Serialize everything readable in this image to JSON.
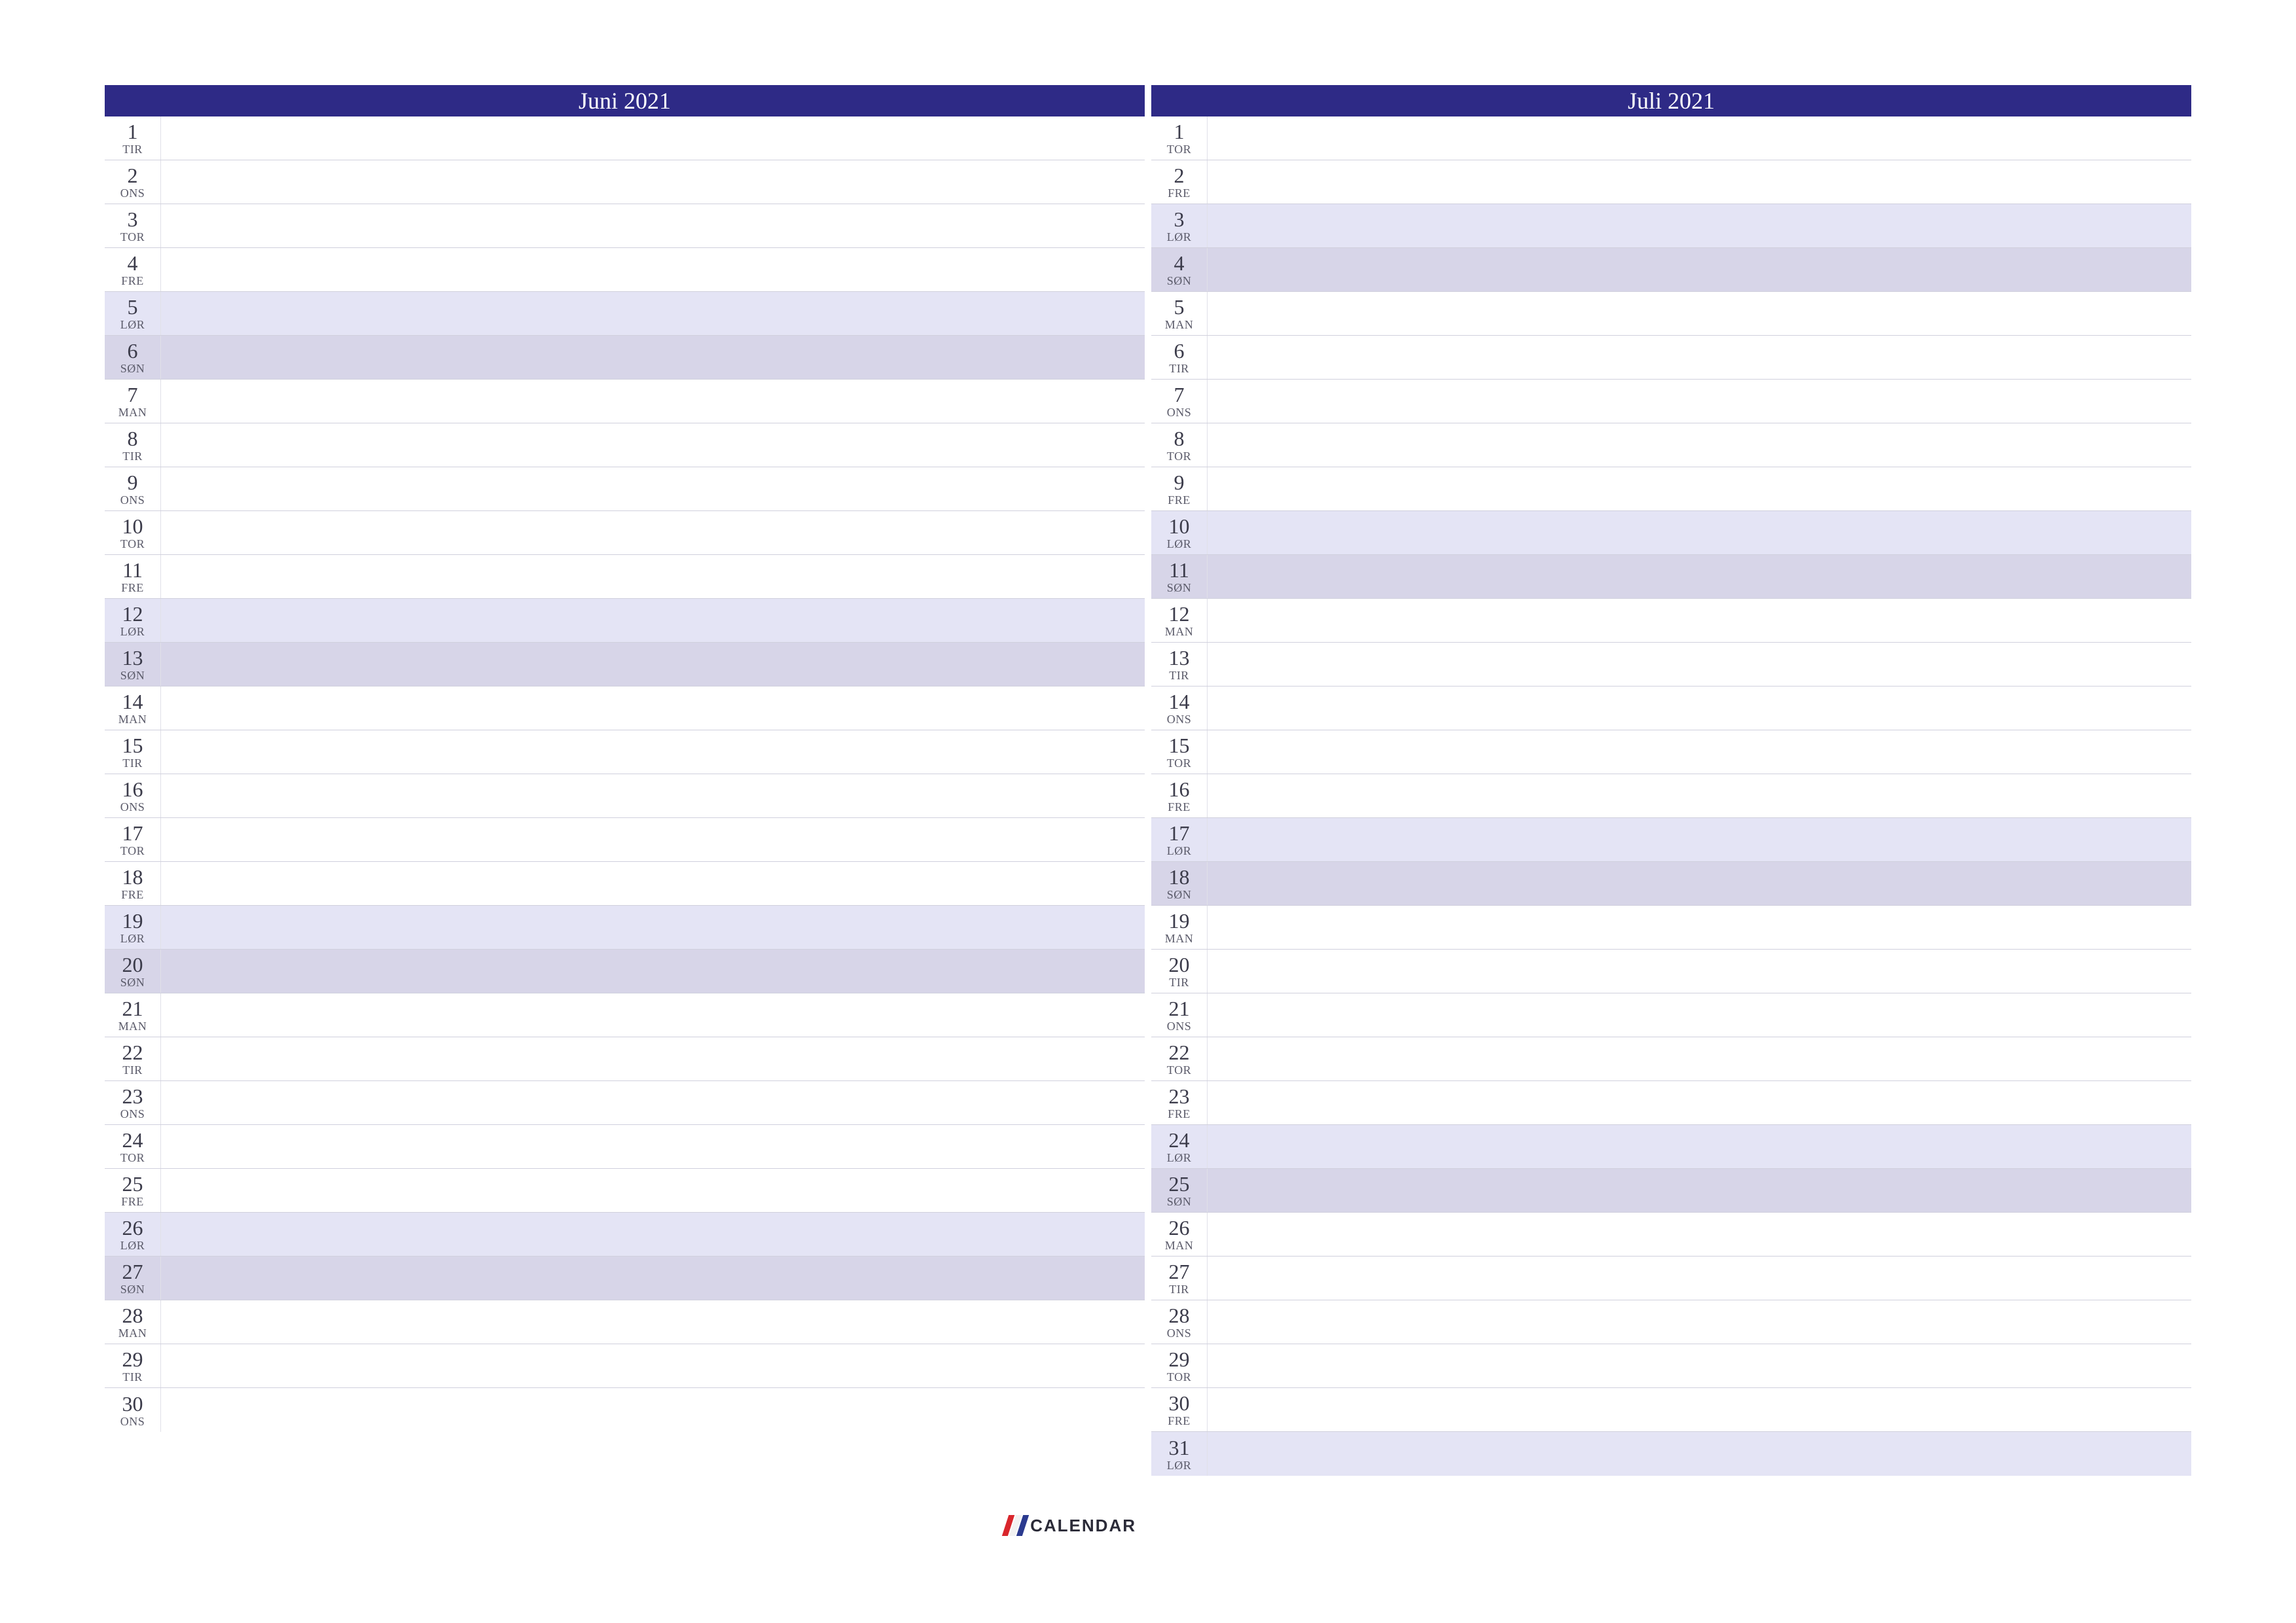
{
  "brand": "CALENDAR",
  "months": [
    {
      "title": "Juni 2021",
      "days": [
        {
          "n": "1",
          "w": "TIR",
          "t": "wd"
        },
        {
          "n": "2",
          "w": "ONS",
          "t": "wd"
        },
        {
          "n": "3",
          "w": "TOR",
          "t": "wd"
        },
        {
          "n": "4",
          "w": "FRE",
          "t": "wd"
        },
        {
          "n": "5",
          "w": "LØR",
          "t": "sat"
        },
        {
          "n": "6",
          "w": "SØN",
          "t": "sun"
        },
        {
          "n": "7",
          "w": "MAN",
          "t": "wd"
        },
        {
          "n": "8",
          "w": "TIR",
          "t": "wd"
        },
        {
          "n": "9",
          "w": "ONS",
          "t": "wd"
        },
        {
          "n": "10",
          "w": "TOR",
          "t": "wd"
        },
        {
          "n": "11",
          "w": "FRE",
          "t": "wd"
        },
        {
          "n": "12",
          "w": "LØR",
          "t": "sat"
        },
        {
          "n": "13",
          "w": "SØN",
          "t": "sun"
        },
        {
          "n": "14",
          "w": "MAN",
          "t": "wd"
        },
        {
          "n": "15",
          "w": "TIR",
          "t": "wd"
        },
        {
          "n": "16",
          "w": "ONS",
          "t": "wd"
        },
        {
          "n": "17",
          "w": "TOR",
          "t": "wd"
        },
        {
          "n": "18",
          "w": "FRE",
          "t": "wd"
        },
        {
          "n": "19",
          "w": "LØR",
          "t": "sat"
        },
        {
          "n": "20",
          "w": "SØN",
          "t": "sun"
        },
        {
          "n": "21",
          "w": "MAN",
          "t": "wd"
        },
        {
          "n": "22",
          "w": "TIR",
          "t": "wd"
        },
        {
          "n": "23",
          "w": "ONS",
          "t": "wd"
        },
        {
          "n": "24",
          "w": "TOR",
          "t": "wd"
        },
        {
          "n": "25",
          "w": "FRE",
          "t": "wd"
        },
        {
          "n": "26",
          "w": "LØR",
          "t": "sat"
        },
        {
          "n": "27",
          "w": "SØN",
          "t": "sun"
        },
        {
          "n": "28",
          "w": "MAN",
          "t": "wd"
        },
        {
          "n": "29",
          "w": "TIR",
          "t": "wd"
        },
        {
          "n": "30",
          "w": "ONS",
          "t": "wd"
        }
      ]
    },
    {
      "title": "Juli 2021",
      "days": [
        {
          "n": "1",
          "w": "TOR",
          "t": "wd"
        },
        {
          "n": "2",
          "w": "FRE",
          "t": "wd"
        },
        {
          "n": "3",
          "w": "LØR",
          "t": "sat"
        },
        {
          "n": "4",
          "w": "SØN",
          "t": "sun"
        },
        {
          "n": "5",
          "w": "MAN",
          "t": "wd"
        },
        {
          "n": "6",
          "w": "TIR",
          "t": "wd"
        },
        {
          "n": "7",
          "w": "ONS",
          "t": "wd"
        },
        {
          "n": "8",
          "w": "TOR",
          "t": "wd"
        },
        {
          "n": "9",
          "w": "FRE",
          "t": "wd"
        },
        {
          "n": "10",
          "w": "LØR",
          "t": "sat"
        },
        {
          "n": "11",
          "w": "SØN",
          "t": "sun"
        },
        {
          "n": "12",
          "w": "MAN",
          "t": "wd"
        },
        {
          "n": "13",
          "w": "TIR",
          "t": "wd"
        },
        {
          "n": "14",
          "w": "ONS",
          "t": "wd"
        },
        {
          "n": "15",
          "w": "TOR",
          "t": "wd"
        },
        {
          "n": "16",
          "w": "FRE",
          "t": "wd"
        },
        {
          "n": "17",
          "w": "LØR",
          "t": "sat"
        },
        {
          "n": "18",
          "w": "SØN",
          "t": "sun"
        },
        {
          "n": "19",
          "w": "MAN",
          "t": "wd"
        },
        {
          "n": "20",
          "w": "TIR",
          "t": "wd"
        },
        {
          "n": "21",
          "w": "ONS",
          "t": "wd"
        },
        {
          "n": "22",
          "w": "TOR",
          "t": "wd"
        },
        {
          "n": "23",
          "w": "FRE",
          "t": "wd"
        },
        {
          "n": "24",
          "w": "LØR",
          "t": "sat"
        },
        {
          "n": "25",
          "w": "SØN",
          "t": "sun"
        },
        {
          "n": "26",
          "w": "MAN",
          "t": "wd"
        },
        {
          "n": "27",
          "w": "TIR",
          "t": "wd"
        },
        {
          "n": "28",
          "w": "ONS",
          "t": "wd"
        },
        {
          "n": "29",
          "w": "TOR",
          "t": "wd"
        },
        {
          "n": "30",
          "w": "FRE",
          "t": "wd"
        },
        {
          "n": "31",
          "w": "LØR",
          "t": "sat"
        }
      ]
    }
  ]
}
